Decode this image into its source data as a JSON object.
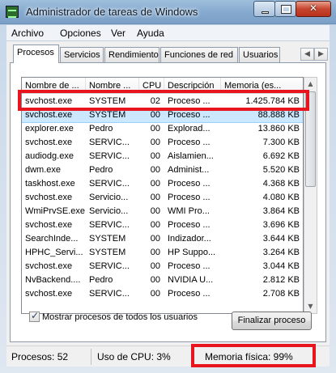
{
  "window": {
    "title": "Administrador de tareas de Windows"
  },
  "menu": [
    "Archivo",
    "Opciones",
    "Ver",
    "Ayuda"
  ],
  "tabs": [
    "Procesos",
    "Servicios",
    "Rendimiento",
    "Funciones de red",
    "Usuarios"
  ],
  "active_tab": "Procesos",
  "columns": [
    "Nombre de ...",
    "Nombre ...",
    "CPU",
    "Descripción",
    "Memoria (es..."
  ],
  "processes": [
    [
      "svchost.exe",
      "SYSTEM",
      "02",
      "Proceso ...",
      "1.425.784 KB"
    ],
    [
      "svchost.exe",
      "SYSTEM",
      "00",
      "Proceso ...",
      "88.888 KB"
    ],
    [
      "explorer.exe",
      "Pedro",
      "00",
      "Explorad...",
      "13.860 KB"
    ],
    [
      "svchost.exe",
      "SERVIC...",
      "00",
      "Proceso ...",
      "7.300 KB"
    ],
    [
      "audiodg.exe",
      "SERVIC...",
      "00",
      "Aislamien...",
      "6.692 KB"
    ],
    [
      "dwm.exe",
      "Pedro",
      "00",
      "Administ...",
      "5.520 KB"
    ],
    [
      "taskhost.exe",
      "SERVIC...",
      "00",
      "Proceso ...",
      "4.368 KB"
    ],
    [
      "svchost.exe",
      "Servicio...",
      "00",
      "Proceso ...",
      "4.080 KB"
    ],
    [
      "WmiPrvSE.exe",
      "Servicio...",
      "00",
      "WMI Pro...",
      "3.864 KB"
    ],
    [
      "svchost.exe",
      "SERVIC...",
      "00",
      "Proceso ...",
      "3.696 KB"
    ],
    [
      "SearchInde...",
      "SYSTEM",
      "00",
      "Indizador...",
      "3.644 KB"
    ],
    [
      "HPHC_Servi...",
      "SYSTEM",
      "00",
      "HP Suppo...",
      "3.264 KB"
    ],
    [
      "svchost.exe",
      "SERVIC...",
      "00",
      "Proceso ...",
      "3.044 KB"
    ],
    [
      "NvBackend....",
      "Pedro",
      "00",
      "NVIDIA U...",
      "2.812 KB"
    ],
    [
      "svchost.exe",
      "SERVIC...",
      "00",
      "Proceso ...",
      "2.708 KB"
    ]
  ],
  "selected_row": 1,
  "show_all_label": "Mostrar procesos de todos los usuarios",
  "show_all_checked": true,
  "end_process_label": "Finalizar proceso",
  "status": {
    "processes": "Procesos: 52",
    "cpu": "Uso de CPU: 3%",
    "memory": "Memoria física: 99%"
  },
  "highlight_color": "#e8141e"
}
